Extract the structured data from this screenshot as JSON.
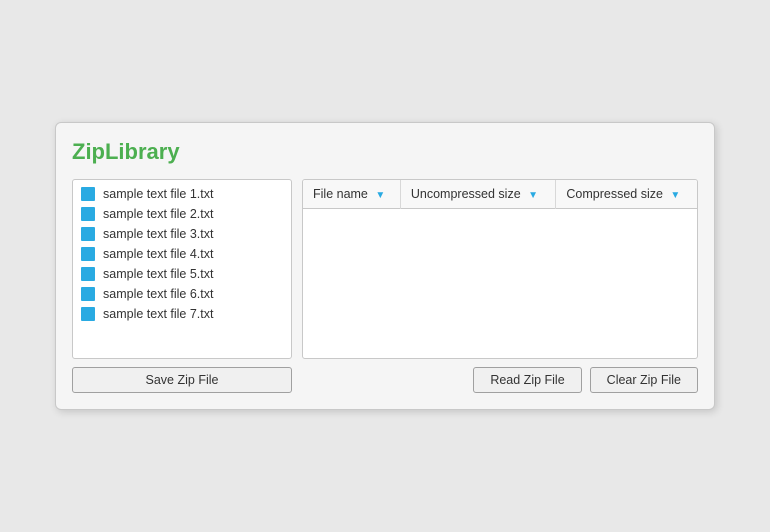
{
  "window": {
    "title": "ZipLibrary"
  },
  "file_list": {
    "items": [
      {
        "name": "sample text file 1.txt"
      },
      {
        "name": "sample text file 2.txt"
      },
      {
        "name": "sample text file 3.txt"
      },
      {
        "name": "sample text file 4.txt"
      },
      {
        "name": "sample text file 5.txt"
      },
      {
        "name": "sample text file 6.txt"
      },
      {
        "name": "sample text file 7.txt"
      }
    ],
    "save_button": "Save Zip File"
  },
  "table": {
    "columns": [
      {
        "id": "file_name",
        "label": "File name"
      },
      {
        "id": "uncompressed_size",
        "label": "Uncompressed size"
      },
      {
        "id": "compressed_size",
        "label": "Compressed size"
      }
    ],
    "rows": []
  },
  "buttons": {
    "read_zip": "Read Zip File",
    "clear_zip": "Clear Zip File"
  }
}
